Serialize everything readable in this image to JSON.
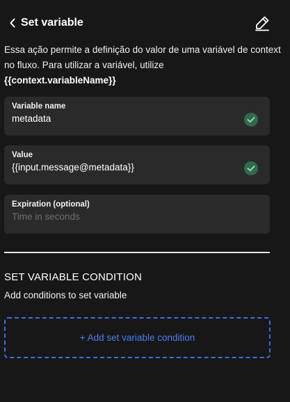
{
  "header": {
    "title": "Set variable",
    "back_icon": "chevron-left-icon",
    "edit_icon": "pencil-icon"
  },
  "description": {
    "text": "Essa ação permite a definição do valor de uma variável de context no fluxo. Para utilizar a variável, utilize",
    "variable_reference": "{{context.variableName}}"
  },
  "fields": [
    {
      "label": "Variable name",
      "value": "metadata",
      "placeholder": "",
      "valid": true
    },
    {
      "label": "Value",
      "value": "{{input.message@metadata}}",
      "placeholder": "",
      "valid": true
    },
    {
      "label": "Expiration (optional)",
      "value": "",
      "placeholder": "Time in seconds",
      "valid": false
    }
  ],
  "condition_section": {
    "title": "SET VARIABLE CONDITION",
    "subtitle": "Add conditions to set variable",
    "add_button_label": "+ Add set variable condition"
  },
  "colors": {
    "background": "#171717",
    "field_background": "#2a2a2a",
    "check_green": "#2f6b4a",
    "accent_blue": "#3d6fe8"
  }
}
